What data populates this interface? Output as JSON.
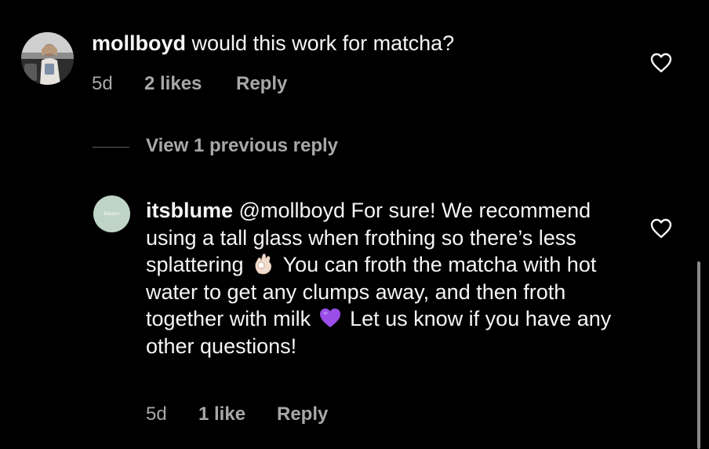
{
  "comment": {
    "username": "mollboyd",
    "text": "would this work for matcha?",
    "time": "5d",
    "likes": "2 likes",
    "reply_label": "Reply",
    "heart_icon": "heart-outline-icon"
  },
  "thread": {
    "view_previous_label": "View 1 previous reply"
  },
  "reply": {
    "username": "itsblume",
    "avatar_text": "blume",
    "avatar_color": "#bfd3c6",
    "text_part1": "@mollboyd For sure! We recommend using a tall glass when frothing so there’s less splattering",
    "emoji1": "ok-hand-emoji",
    "text_part2": "You can froth the matcha with hot water to get any clumps away, and then froth together with milk",
    "emoji2": "purple-heart-emoji",
    "text_part3": "Let us know if you have any other questions!",
    "time": "5d",
    "likes": "1 like",
    "reply_label": "Reply",
    "heart_icon": "heart-outline-icon"
  },
  "colors": {
    "background": "#000000",
    "primary_text": "#f5f5f5",
    "secondary_text": "#a8a8a8",
    "purple_heart": "#9b4de8"
  }
}
